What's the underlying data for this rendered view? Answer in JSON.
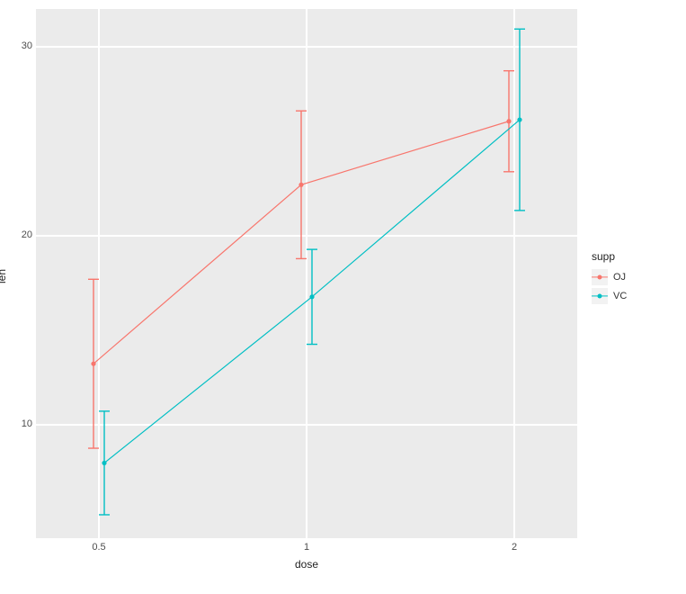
{
  "chart_data": {
    "type": "line",
    "title": "",
    "xlabel": "dose",
    "ylabel": "len",
    "x_categories": [
      "0.5",
      "1",
      "2"
    ],
    "y_ticks": [
      10,
      20,
      30
    ],
    "ylim": [
      4,
      32
    ],
    "legend_title": "supp",
    "series": [
      {
        "name": "OJ",
        "color": "#F8766D",
        "x": [
          0.5,
          1,
          2
        ],
        "mean": [
          13.23,
          22.7,
          26.06
        ],
        "lower": [
          8.76,
          18.79,
          23.39
        ],
        "upper": [
          17.7,
          26.61,
          28.73
        ]
      },
      {
        "name": "VC",
        "color": "#00BFC4",
        "x": [
          0.5,
          1,
          2
        ],
        "mean": [
          7.98,
          16.77,
          26.14
        ],
        "lower": [
          5.24,
          14.26,
          21.34
        ],
        "upper": [
          10.72,
          19.28,
          30.94
        ]
      }
    ]
  }
}
